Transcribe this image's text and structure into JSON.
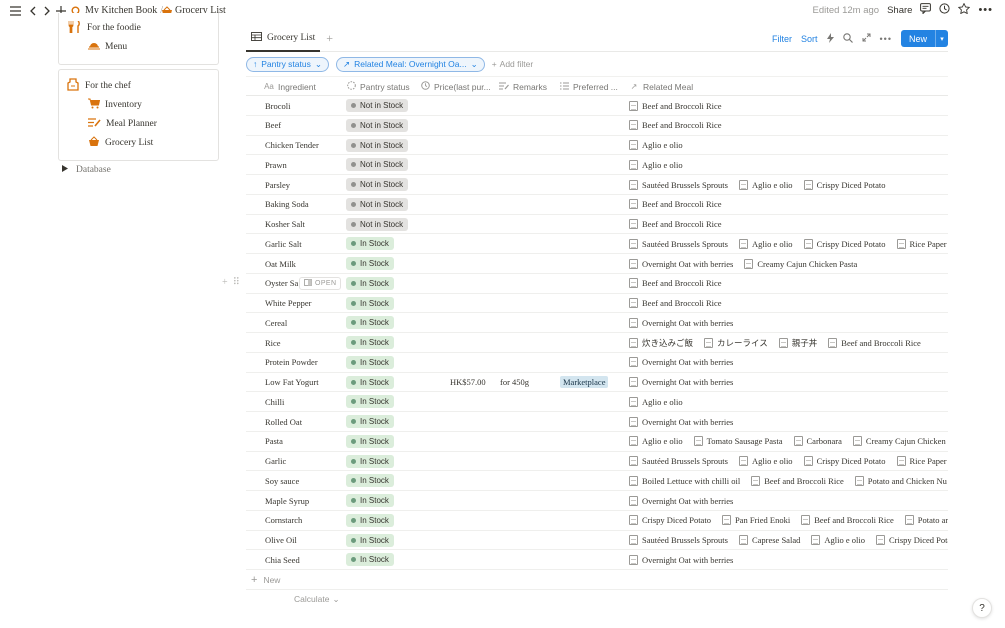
{
  "topbar": {
    "breadcrumb_1": "My Kitchen Book",
    "separator": "/",
    "breadcrumb_2": "Grocery List",
    "edited": "Edited 12m ago",
    "share": "Share"
  },
  "sidebar": {
    "foodie_group": {
      "label": "For the foodie",
      "items": [
        {
          "label": "Menu"
        }
      ]
    },
    "chef_group": {
      "label": "For the chef",
      "items": [
        {
          "label": "Inventory"
        },
        {
          "label": "Meal Planner"
        },
        {
          "label": "Grocery List"
        }
      ]
    },
    "database": "Database"
  },
  "view": {
    "tab": "Grocery List",
    "filter": "Filter",
    "sort": "Sort",
    "new": "New"
  },
  "filters": {
    "pantry_chip": "Pantry status",
    "meal_chip": "Related Meal: Overnight Oa...",
    "add_filter": "Add filter"
  },
  "columns": {
    "ingredient": "Ingredient",
    "pantry": "Pantry status",
    "price": "Price(last pur...",
    "remarks": "Remarks",
    "preferred": "Preferred ...",
    "meal": "Related Meal"
  },
  "status_colors": {
    "not_in_stock": {
      "bg": "#e3e2e0",
      "dot": "#91918e"
    },
    "in_stock": {
      "bg": "#dbeddb",
      "dot": "#6c9b7d"
    }
  },
  "rows": [
    {
      "ingredient": "Brocoli",
      "status": "Not in Stock",
      "price": "",
      "remarks": "",
      "preferred": "",
      "meals": [
        "Beef and Broccoli Rice"
      ]
    },
    {
      "ingredient": "Beef",
      "status": "Not in Stock",
      "price": "",
      "remarks": "",
      "preferred": "",
      "meals": [
        "Beef and Broccoli Rice"
      ]
    },
    {
      "ingredient": "Chicken Tender",
      "status": "Not in Stock",
      "price": "",
      "remarks": "",
      "preferred": "",
      "meals": [
        "Aglio e olio"
      ]
    },
    {
      "ingredient": "Prawn",
      "status": "Not in Stock",
      "price": "",
      "remarks": "",
      "preferred": "",
      "meals": [
        "Aglio e olio"
      ]
    },
    {
      "ingredient": "Parsley",
      "status": "Not in Stock",
      "price": "",
      "remarks": "",
      "preferred": "",
      "meals": [
        "Sautéed Brussels Sprouts",
        "Aglio e olio",
        "Crispy Diced Potato"
      ]
    },
    {
      "ingredient": "Baking Soda",
      "status": "Not in Stock",
      "price": "",
      "remarks": "",
      "preferred": "",
      "meals": [
        "Beef and Broccoli Rice"
      ]
    },
    {
      "ingredient": "Kosher Salt",
      "status": "Not in Stock",
      "price": "",
      "remarks": "",
      "preferred": "",
      "meals": [
        "Beef and Broccoli Rice"
      ]
    },
    {
      "ingredient": "Garlic Salt",
      "status": "In Stock",
      "price": "",
      "remarks": "",
      "preferred": "",
      "meals": [
        "Sautéed Brussels Sprouts",
        "Aglio e olio",
        "Crispy Diced Potato",
        "Rice Paper D"
      ]
    },
    {
      "ingredient": "Oat Milk",
      "status": "In Stock",
      "price": "",
      "remarks": "",
      "preferred": "",
      "meals": [
        "Overnight Oat with berries",
        "Creamy Cajun Chicken Pasta"
      ]
    },
    {
      "ingredient": "Oyster Sa",
      "status": "In Stock",
      "price": "",
      "remarks": "",
      "preferred": "",
      "meals": [
        "Beef and Broccoli Rice"
      ],
      "open": "OPEN"
    },
    {
      "ingredient": "White Pepper",
      "status": "In Stock",
      "price": "",
      "remarks": "",
      "preferred": "",
      "meals": [
        "Beef and Broccoli Rice"
      ]
    },
    {
      "ingredient": "Cereal",
      "status": "In Stock",
      "price": "",
      "remarks": "",
      "preferred": "",
      "meals": [
        "Overnight Oat with berries"
      ]
    },
    {
      "ingredient": "Rice",
      "status": "In Stock",
      "price": "",
      "remarks": "",
      "preferred": "",
      "meals": [
        "炊き込みご飯",
        "カレーライス",
        "親子丼",
        "Beef and Broccoli Rice"
      ]
    },
    {
      "ingredient": "Protein Powder",
      "status": "In Stock",
      "price": "",
      "remarks": "",
      "preferred": "",
      "meals": [
        "Overnight Oat with berries"
      ]
    },
    {
      "ingredient": "Low Fat Yogurt",
      "status": "In Stock",
      "price": "HK$57.00",
      "remarks": "for 450g",
      "preferred": "Marketplace",
      "meals": [
        "Overnight Oat with berries"
      ]
    },
    {
      "ingredient": "Chilli",
      "status": "In Stock",
      "price": "",
      "remarks": "",
      "preferred": "",
      "meals": [
        "Aglio e olio"
      ]
    },
    {
      "ingredient": "Rolled Oat",
      "status": "In Stock",
      "price": "",
      "remarks": "",
      "preferred": "",
      "meals": [
        "Overnight Oat with berries"
      ]
    },
    {
      "ingredient": "Pasta",
      "status": "In Stock",
      "price": "",
      "remarks": "",
      "preferred": "",
      "meals": [
        "Aglio e olio",
        "Tomato Sausage Pasta",
        "Carbonara",
        "Creamy Cajun Chicken P"
      ]
    },
    {
      "ingredient": "Garlic",
      "status": "In Stock",
      "price": "",
      "remarks": "",
      "preferred": "",
      "meals": [
        "Sautéed Brussels Sprouts",
        "Aglio e olio",
        "Crispy Diced Potato",
        "Rice Paper D"
      ]
    },
    {
      "ingredient": "Soy sauce",
      "status": "In Stock",
      "price": "",
      "remarks": "",
      "preferred": "",
      "meals": [
        "Boiled Lettuce with chilli oil",
        "Beef and Broccoli Rice",
        "Potato and Chicken Nu"
      ]
    },
    {
      "ingredient": "Maple Syrup",
      "status": "In Stock",
      "price": "",
      "remarks": "",
      "preferred": "",
      "meals": [
        "Overnight Oat with berries"
      ]
    },
    {
      "ingredient": "Cornstarch",
      "status": "In Stock",
      "price": "",
      "remarks": "",
      "preferred": "",
      "meals": [
        "Crispy Diced Potato",
        "Pan Fried Enoki",
        "Beef and Broccoli Rice",
        "Potato and"
      ]
    },
    {
      "ingredient": "Olive Oil",
      "status": "In Stock",
      "price": "",
      "remarks": "",
      "preferred": "",
      "meals": [
        "Sautéed Brussels Sprouts",
        "Caprese Salad",
        "Aglio e olio",
        "Crispy Diced Potat"
      ]
    },
    {
      "ingredient": "Chia Seed",
      "status": "In Stock",
      "price": "",
      "remarks": "",
      "preferred": "",
      "meals": [
        "Overnight Oat with berries"
      ]
    }
  ],
  "footer": {
    "new_row": "New",
    "calculate": "Calculate",
    "help": "?"
  }
}
